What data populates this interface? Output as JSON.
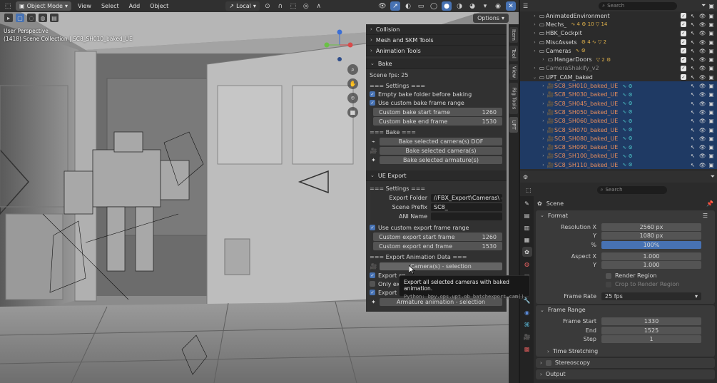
{
  "header": {
    "mode_label": "Object Mode",
    "menus": [
      "View",
      "Select",
      "Add",
      "Object"
    ],
    "transform_orientation": "Local"
  },
  "viewport": {
    "options_label": "Options",
    "perspective_label": "User Perspective",
    "scene_info": "(1418) Scene Collection | SC8_SH010_baked_UE"
  },
  "npanel": {
    "sections_top": [
      "Collision",
      "Mesh and SKM Tools",
      "Animation Tools"
    ],
    "bake": {
      "title": "Bake",
      "scene_fps": "Scene fps: 25",
      "settings_header": "=== Settings ===",
      "empty_folder": "Empty bake folder before baking",
      "use_custom_range": "Use custom bake frame range",
      "start_label": "Custom bake start frame",
      "start_value": "1260",
      "end_label": "Custom bake end frame",
      "end_value": "1530",
      "bake_header": "=== Bake ===",
      "btn_dof": "Bake selected camera(s) DOF",
      "btn_cameras": "Bake selected camera(s)",
      "btn_armatures": "Bake selected armature(s)"
    },
    "ue_export": {
      "title": "UE Export",
      "settings_header": "=== Settings ===",
      "export_folder_label": "Export Folder",
      "export_folder_value": "//FBX_Export\\Cameras\\",
      "scene_prefix_label": "Scene Prefix",
      "scene_prefix_value": "SC8_",
      "ani_name_label": "ANI Name",
      "ani_name_value": "",
      "use_custom_range": "Use custom export frame range",
      "start_label": "Custom export start frame",
      "start_value": "1260",
      "end_label": "Custom export end frame",
      "end_value": "1530",
      "anim_header": "=== Export Animation Data ===",
      "btn_cameras": "Camera(s) - selection",
      "check_export_an": "Export an",
      "check_only_exp": "Only exp",
      "check_export_a": "Export a",
      "btn_armature": "Armature animation - selection"
    },
    "vertical_tabs": [
      "Item",
      "Tool",
      "View",
      "Rig Tools",
      "UPT"
    ]
  },
  "tooltip": {
    "text": "Export all selected cameras with baked animation.",
    "python": "Python: bpy.ops.upt.ob_batchexport_cam()"
  },
  "outliner": {
    "search_placeholder": "Search",
    "rows": [
      {
        "name": "AnimatedEnvironment",
        "extra": "",
        "style": "",
        "indent": 16,
        "sel": false
      },
      {
        "name": "Mechs_",
        "extra": "∿ 4 ⚙ 10 ▽ 14",
        "style": "",
        "indent": 16,
        "sel": false
      },
      {
        "name": "HBK_Cockpit",
        "extra": "",
        "style": "",
        "indent": 16,
        "sel": false
      },
      {
        "name": "MiscAssets",
        "extra": "⚙ 4 ∿ ▽ 2",
        "style": "",
        "indent": 16,
        "sel": false
      },
      {
        "name": "Cameras",
        "extra": "∿ ⚙",
        "style": "",
        "indent": 16,
        "sel": false
      },
      {
        "name": "HangarDoors",
        "extra": "▽ 2 ⚙",
        "style": "",
        "indent": 28,
        "sel": false
      },
      {
        "name": "CameraShakify_v2",
        "extra": "",
        "style": "dim",
        "indent": 16,
        "sel": false
      },
      {
        "name": "UPT_CAM_baked",
        "extra": "",
        "style": "",
        "indent": 16,
        "sel": false
      },
      {
        "name": "SC8_SH010_baked_UE",
        "extra": "∿ ⚙",
        "style": "cam",
        "indent": 28,
        "sel": true
      },
      {
        "name": "SC8_SH030_baked_UE",
        "extra": "∿ ⚙",
        "style": "cam",
        "indent": 28,
        "sel": true
      },
      {
        "name": "SC8_SH045_baked_UE",
        "extra": "∿ ⚙",
        "style": "cam",
        "indent": 28,
        "sel": true
      },
      {
        "name": "SC8_SH050_baked_UE",
        "extra": "∿ ⚙",
        "style": "cam",
        "indent": 28,
        "sel": true
      },
      {
        "name": "SC8_SH060_baked_UE",
        "extra": "∿ ⚙",
        "style": "cam",
        "indent": 28,
        "sel": true
      },
      {
        "name": "SC8_SH070_baked_UE",
        "extra": "∿ ⚙",
        "style": "cam",
        "indent": 28,
        "sel": true
      },
      {
        "name": "SC8_SH080_baked_UE",
        "extra": "∿ ⚙",
        "style": "cam",
        "indent": 28,
        "sel": true
      },
      {
        "name": "SC8_SH090_baked_UE",
        "extra": "∿ ⚙",
        "style": "cam",
        "indent": 28,
        "sel": true
      },
      {
        "name": "SC8_SH100_baked_UE",
        "extra": "∿ ⚙",
        "style": "cam",
        "indent": 28,
        "sel": true
      },
      {
        "name": "SC8_SH110_baked_UE",
        "extra": "∿ ⚙",
        "style": "cam",
        "indent": 28,
        "sel": true
      }
    ]
  },
  "properties": {
    "search_placeholder": "Search",
    "title": "Scene",
    "format": {
      "title": "Format",
      "resolution_x_label": "Resolution X",
      "resolution_x": "2560 px",
      "y_label": "Y",
      "resolution_y": "1080 px",
      "percent_label": "%",
      "percent": "100%",
      "aspect_x_label": "Aspect X",
      "aspect_x": "1.000",
      "aspect_y_label": "Y",
      "aspect_y": "1.000",
      "render_region": "Render Region",
      "crop_region": "Crop to Render Region",
      "frame_rate_label": "Frame Rate",
      "frame_rate": "25 fps"
    },
    "frame_range": {
      "title": "Frame Range",
      "start_label": "Frame Start",
      "start": "1330",
      "end_label": "End",
      "end": "1525",
      "step_label": "Step",
      "step": "1",
      "time_stretching": "Time Stretching"
    },
    "stereoscopy": "Stereoscopy",
    "output": "Output"
  },
  "colors": {
    "accent": "#4772b3",
    "selection": "#1f3a64",
    "camera_text": "#e78d5c"
  }
}
